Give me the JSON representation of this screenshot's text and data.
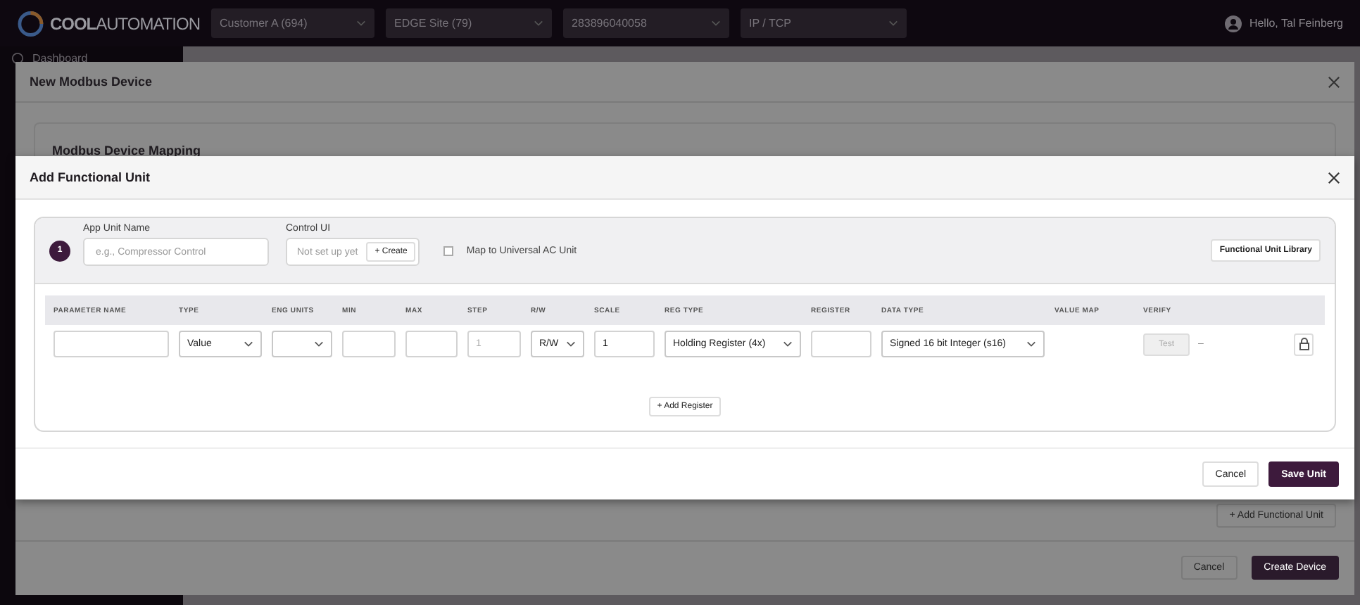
{
  "top_bar": {
    "logo_bold": "COOL",
    "logo_light": "AUTOMATION",
    "selects": [
      "Customer A (694)",
      "EDGE Site (79)",
      "283896040058",
      "IP / TCP"
    ],
    "user": "Hello, Tal Feinberg"
  },
  "sidebar": {
    "items": [
      "Dashboard"
    ]
  },
  "device_modal": {
    "title": "New Modbus Device",
    "section_title": "Modbus Device Mapping",
    "add_unit_button": "+ Add Functional Unit",
    "buttons": [
      "Cancel",
      "Create Device"
    ]
  },
  "unit_modal": {
    "title": "Add Functional Unit",
    "unit_number": "1",
    "name_field": {
      "label": "App Unit Name",
      "placeholder": "e.g., Compressor Control"
    },
    "control_ui": {
      "label": "Control UI",
      "status": "Not set up yet",
      "button": "+ Create"
    },
    "map_checkbox": {
      "label": "Map to Universal AC Unit",
      "checked": false
    },
    "library_button": "Functional Unit Library",
    "table": {
      "columns": [
        "PARAMETER NAME",
        "TYPE",
        "ENG UNITS",
        "MIN",
        "MAX",
        "STEP",
        "R/W",
        "SCALE",
        "REG TYPE",
        "REGISTER",
        "DATA TYPE",
        "VALUE MAP",
        "VERIFY"
      ],
      "rows": [
        {
          "cells": [
            {
              "kind": "input"
            },
            {
              "kind": "select",
              "value": "Value"
            },
            {
              "kind": "select"
            },
            {
              "kind": "input"
            },
            {
              "kind": "input"
            },
            {
              "kind": "input",
              "placeholder": "1"
            },
            {
              "kind": "select",
              "value": "R/W"
            },
            {
              "kind": "input",
              "value": "1"
            },
            {
              "kind": "select",
              "value": "Holding Register (4x)"
            },
            {
              "kind": "input"
            },
            {
              "kind": "select",
              "value": "Signed 16 bit Integer (s16)"
            },
            {
              "kind": "empty"
            },
            {
              "kind": "test",
              "label": "Test",
              "disabled": true,
              "result": "–"
            },
            {
              "kind": "lock"
            }
          ]
        }
      ]
    },
    "add_register_button": "+ Add Register",
    "buttons": [
      "Cancel",
      "Save Unit"
    ]
  }
}
